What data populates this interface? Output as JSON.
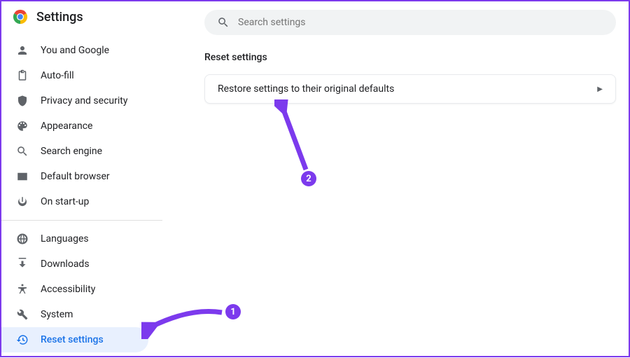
{
  "header": {
    "title": "Settings"
  },
  "search": {
    "placeholder": "Search settings"
  },
  "sidebar": {
    "groups": [
      {
        "items": [
          {
            "label": "You and Google"
          },
          {
            "label": "Auto-fill"
          },
          {
            "label": "Privacy and security"
          },
          {
            "label": "Appearance"
          },
          {
            "label": "Search engine"
          },
          {
            "label": "Default browser"
          },
          {
            "label": "On start-up"
          }
        ]
      },
      {
        "items": [
          {
            "label": "Languages"
          },
          {
            "label": "Downloads"
          },
          {
            "label": "Accessibility"
          },
          {
            "label": "System"
          },
          {
            "label": "Reset settings"
          }
        ]
      }
    ]
  },
  "main": {
    "section_title": "Reset settings",
    "card_label": "Restore settings to their original defaults"
  },
  "annotations": {
    "bubble1": "1",
    "bubble2": "2"
  }
}
